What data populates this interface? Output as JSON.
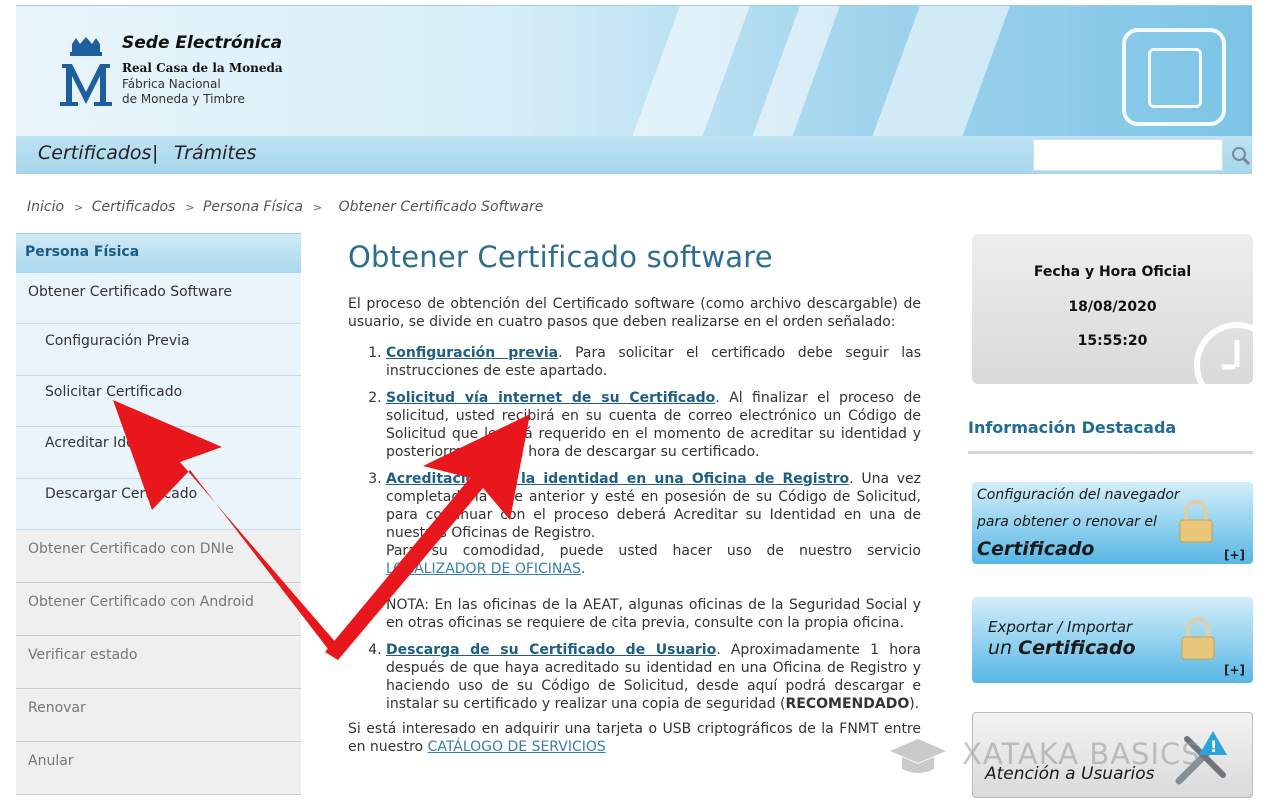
{
  "header": {
    "site_title": "Sede Electrónica",
    "org_line1": "Real Casa de la Moneda",
    "org_line2": "Fábrica Nacional",
    "org_line3": "de Moneda y Timbre"
  },
  "nav": {
    "items": [
      "Certificados",
      "Trámites"
    ],
    "separator": "|",
    "search_value": ""
  },
  "breadcrumb": [
    "Inicio",
    "Certificados",
    "Persona Física",
    "Obtener Certificado Software"
  ],
  "sidebar": {
    "heading": "Persona Física",
    "active_item": "Obtener Certificado Software",
    "sub_items": [
      "Configuración Previa",
      "Solicitar Certificado",
      "Acreditar Identidad",
      "Descargar Certificado"
    ],
    "other_items": [
      "Obtener Certificado con DNIe",
      "Obtener Certificado con Android",
      "Verificar estado",
      "Renovar",
      "Anular"
    ]
  },
  "main": {
    "title": "Obtener Certificado software",
    "intro": "El proceso de obtención del Certificado software (como archivo descargable) de usuario, se divide en cuatro pasos que deben realizarse en el orden señalado:",
    "steps": [
      {
        "link": "Configuración previa",
        "text": ". Para solicitar el certificado debe seguir las instrucciones de este apartado."
      },
      {
        "link": "Solicitud vía internet de su Certificado",
        "text": ". Al finalizar el proceso de solicitud, usted recibirá en su cuenta de correo electrónico un Código de Solicitud que le será requerido en el momento de acreditar su identidad y posteriormente a la hora de descargar su certificado."
      },
      {
        "link": "Acreditación de la identidad en una Oficina de Registro",
        "text": ". Una vez completada la fase anterior y esté en posesión de su Código de Solicitud, para continuar con el proceso deberá Acreditar su Identidad en una de nuestras Oficinas de Registro.",
        "extra": "Para su comodidad, puede usted hacer uso de nuestro servicio ",
        "extra_link": "LOCALIZADOR DE OFICINAS",
        "note": "NOTA: En las oficinas de la AEAT, algunas oficinas de la Seguridad Social y en otras oficinas se requiere de cita previa, consulte con la propia oficina."
      },
      {
        "link": "Descarga de su Certificado de Usuario",
        "text": ". Aproximadamente 1 hora después de que haya acreditado su identidad en una Oficina de Registro y haciendo uso de su Código de Solicitud, desde aquí podrá descargar e instalar su certificado y realizar una copia de seguridad (",
        "bold": "RECOMENDADO",
        "end": ")."
      }
    ],
    "outro": "Si está interesado en adquirir una tarjeta o USB criptográficos de la FNMT entre en nuestro ",
    "outro_link": "CATÁLOGO DE SERVICIOS"
  },
  "clock": {
    "title": "Fecha y Hora Oficial",
    "date": "18/08/2020",
    "time": "15:55:20"
  },
  "info": {
    "title": "Información Destacada",
    "banner1_line1": "Configuración del navegador",
    "banner1_line2": "para obtener o renovar el",
    "banner1_line3": "Certificado",
    "banner2_line1": "Exportar / Importar",
    "banner2_line2a": "un ",
    "banner2_line2b": "Certificado",
    "banner3": "Atención a Usuarios",
    "plus": "[+]"
  },
  "watermark": "XATAKA BASICS",
  "colors": {
    "accent": "#2d6d91",
    "link": "#1d5f85",
    "arrow": "#e8171b"
  }
}
